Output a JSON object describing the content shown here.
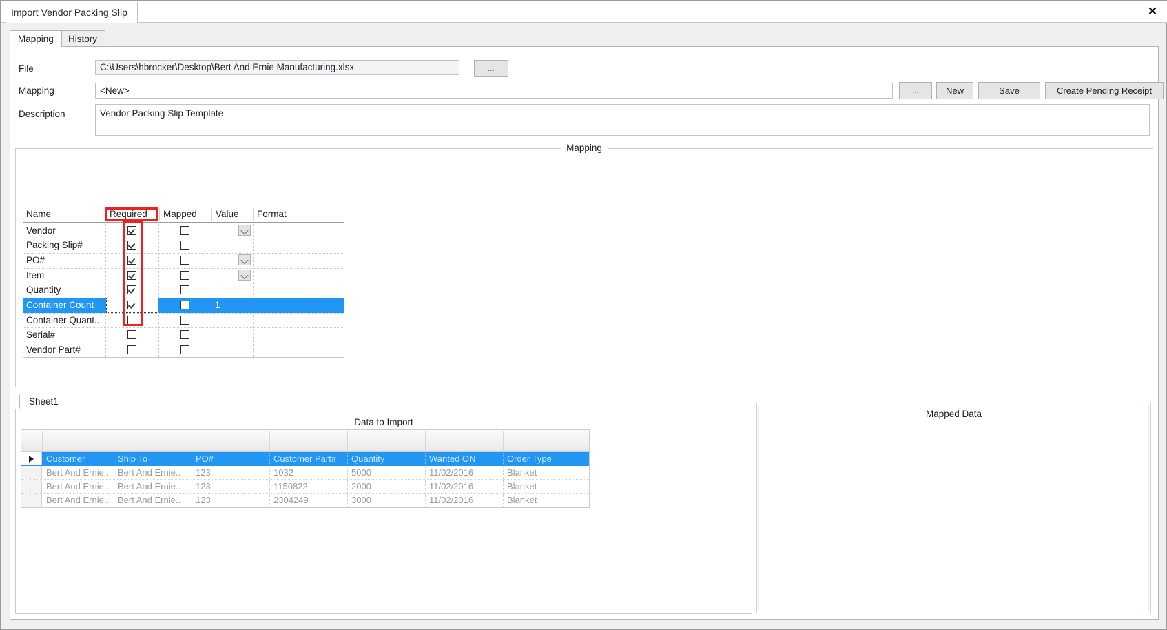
{
  "window": {
    "document_tab": "Import Vendor Packing Slip",
    "close_icon": "close-icon",
    "close_glyph": "✕"
  },
  "tabs": [
    {
      "label": "Mapping",
      "active": true
    },
    {
      "label": "History",
      "active": false
    }
  ],
  "form": {
    "file_label": "File",
    "file_value": "C:\\Users\\hbrocker\\Desktop\\Bert And Ernie Manufacturing.xlsx",
    "file_browse_label": "...",
    "mapping_label": "Mapping",
    "mapping_value": "<New>",
    "mapping_browse_label": "...",
    "description_label": "Description",
    "description_value": "Vendor Packing Slip Template"
  },
  "buttons": {
    "new": "New",
    "save": "Save",
    "create_pending_receipt": "Create Pending Receipt"
  },
  "mapping_group": {
    "title": "Mapping",
    "columns": [
      "Name",
      "Required",
      "Mapped",
      "Value",
      "Format"
    ],
    "rows": [
      {
        "name": "Vendor",
        "required": true,
        "mapped": false,
        "value": "",
        "format": "",
        "has_dropdown": true,
        "selected": false
      },
      {
        "name": "Packing Slip#",
        "required": true,
        "mapped": false,
        "value": "",
        "format": "",
        "has_dropdown": false,
        "selected": false
      },
      {
        "name": "PO#",
        "required": true,
        "mapped": false,
        "value": "",
        "format": "",
        "has_dropdown": true,
        "selected": false
      },
      {
        "name": "Item",
        "required": true,
        "mapped": false,
        "value": "",
        "format": "",
        "has_dropdown": true,
        "selected": false
      },
      {
        "name": "Quantity",
        "required": true,
        "mapped": false,
        "value": "",
        "format": "",
        "has_dropdown": false,
        "selected": false
      },
      {
        "name": "Container Count",
        "required": true,
        "mapped": false,
        "value": "1",
        "format": "",
        "has_dropdown": false,
        "selected": true
      },
      {
        "name": "Container  Quant...",
        "required": false,
        "mapped": false,
        "value": "",
        "format": "",
        "has_dropdown": false,
        "selected": false
      },
      {
        "name": "Serial#",
        "required": false,
        "mapped": false,
        "value": "",
        "format": "",
        "has_dropdown": false,
        "selected": false
      },
      {
        "name": "Vendor Part#",
        "required": false,
        "mapped": false,
        "value": "",
        "format": "",
        "has_dropdown": false,
        "selected": false
      }
    ],
    "annotations": {
      "highlight_color": "#ee2222",
      "highlighted_column": "Required"
    }
  },
  "sheet": {
    "tab_label": "Sheet1",
    "data_title": "Data to Import",
    "columns": [
      "Customer",
      "Ship To",
      "PO#",
      "Customer Part#",
      "Quantity",
      "Wanted ON",
      "Order Type"
    ],
    "rows": [
      [
        "Bert And Ernie..",
        "Bert And Ernie..",
        "123",
        "1032",
        "5000",
        "11/02/2016",
        "Blanket"
      ],
      [
        "Bert And Ernie..",
        "Bert And Ernie..",
        "123",
        "1150822",
        "2000",
        "11/02/2016",
        "Blanket"
      ],
      [
        "Bert And Ernie..",
        "Bert And Ernie..",
        "123",
        "2304249",
        "3000",
        "11/02/2016",
        "Blanket"
      ]
    ]
  },
  "mapped_data": {
    "title": "Mapped Data"
  },
  "colors": {
    "selection_blue": "#2196f3",
    "annotation_red": "#ee2222",
    "window_chrome": "#f0f0f0"
  }
}
